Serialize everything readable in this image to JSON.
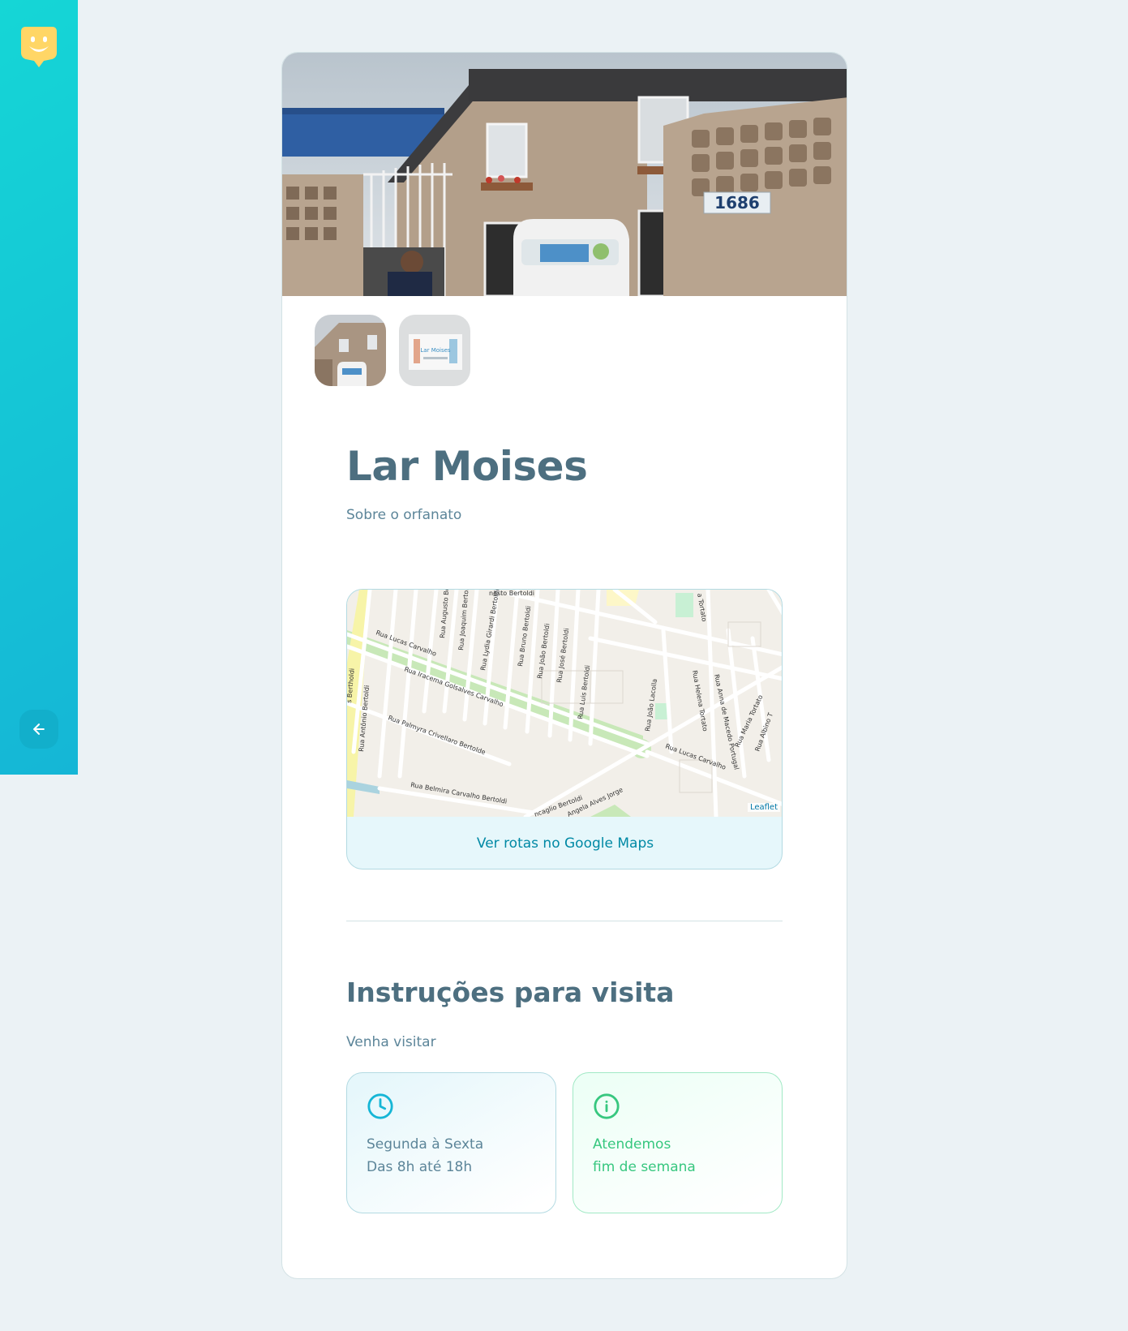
{
  "sidebar": {
    "logo_icon": "happy-face-pin-icon",
    "back_icon": "arrow-left-icon"
  },
  "orphanage": {
    "name": "Lar Moises",
    "about": "Sobre o orfanato",
    "house_number": "1686",
    "thumbnail_flyer_text": "Lar Moises"
  },
  "map": {
    "link_label": "Ver rotas no Google Maps",
    "attribution": "Leaflet",
    "streets": [
      "Rua Lucas Carvalho",
      "Rua Iracema Golsalves Carvalho",
      "Rua Palmyra Crivellaro Bertolde",
      "Rua Belmira Carvalho Bertoldi",
      "Rua Antônio Bertoldi",
      "Rua Augusto Bertoldi",
      "Rua Joaquim Bertoldi",
      "Rua Lydia Girardi Bertoldi",
      "Rua Bruno Bertoldi",
      "Rua João Bertoldi",
      "Rua José Bertoldi",
      "Rua Luis Bertoldi",
      "Rua João Lacolla",
      "Rua Helena Tortato",
      "Rua Anna de Macedo Portugal",
      "Rua Maria Tortato",
      "Rua Albino T",
      "Rua Lucas Carvalho",
      "Angela Alves Jorge",
      "ncaglio Bertoldi",
      "nesto Bertoldi",
      "a Tortato",
      "s Bertholdi"
    ]
  },
  "instructions": {
    "title": "Instruções para visita",
    "text": "Venha visitar",
    "hours": {
      "icon": "clock-icon",
      "line1": "Segunda à Sexta",
      "line2": "Das 8h até 18h"
    },
    "weekend": {
      "icon": "info-icon",
      "line1": "Atendemos",
      "line2": "fim de semana"
    }
  },
  "colors": {
    "sidebar_gradient_start": "#15b6d6",
    "sidebar_gradient_end": "#15d6d6",
    "logo_yellow": "#ffd666",
    "title": "#4d6f80",
    "text": "#5c8599",
    "link": "#0089a5",
    "weekend_green": "#37c77f",
    "background": "#ebf2f5"
  }
}
